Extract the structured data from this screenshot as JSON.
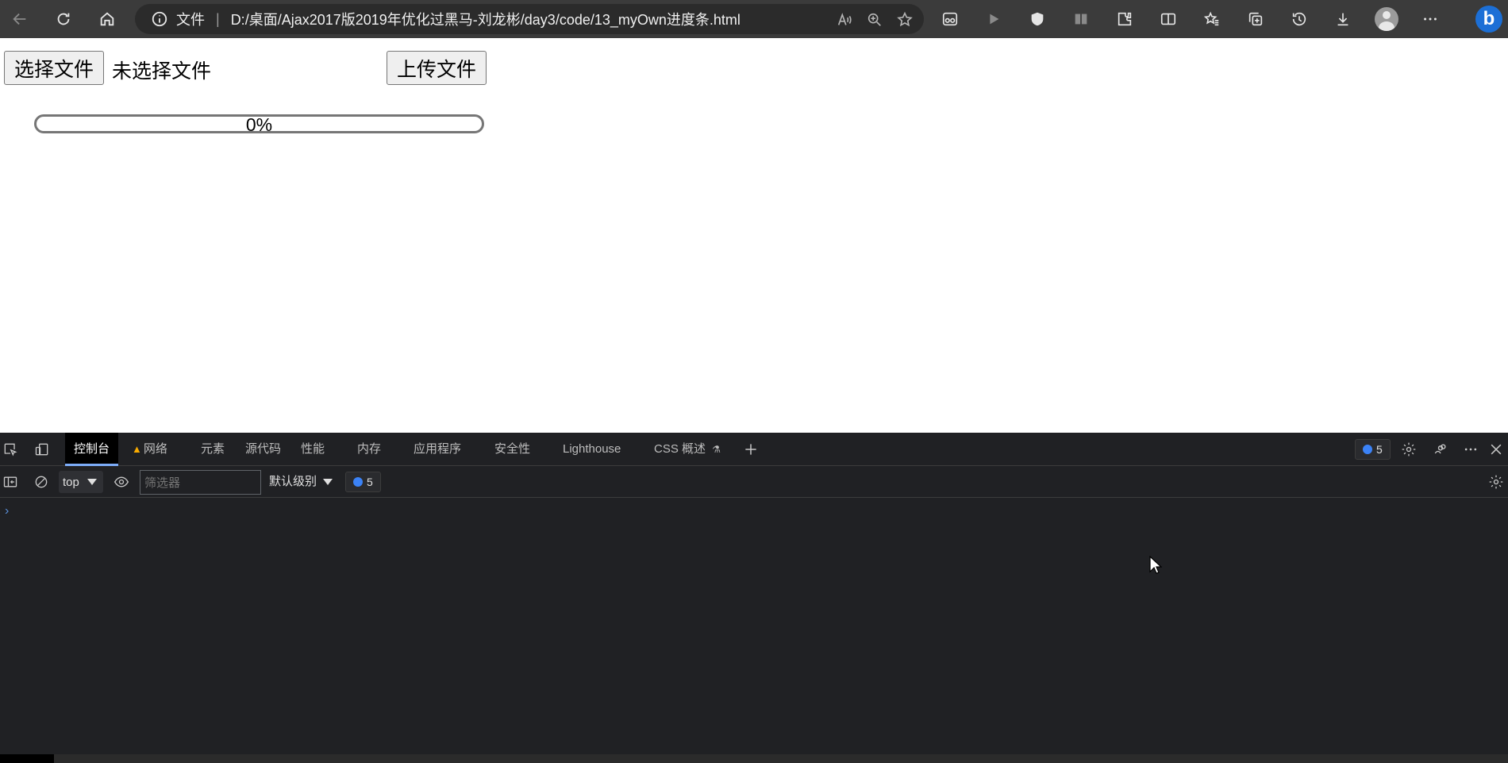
{
  "browser": {
    "address": {
      "scheme_label": "文件",
      "url": "D:/桌面/Ajax2017版2019年优化过黑马-刘龙彬/day3/code/13_myOwn进度条.html"
    }
  },
  "page": {
    "choose_file_label": "选择文件",
    "file_status": "未选择文件",
    "upload_label": "上传文件",
    "progress": {
      "value": 0,
      "text": "0%",
      "fill_color": "#4caf50"
    }
  },
  "devtools": {
    "tabs": [
      {
        "label": "控制台"
      },
      {
        "label": "网络"
      },
      {
        "label": "元素"
      },
      {
        "label": "源代码"
      },
      {
        "label": "性能"
      },
      {
        "label": "内存"
      },
      {
        "label": "应用程序"
      },
      {
        "label": "安全性"
      },
      {
        "label": "Lighthouse"
      },
      {
        "label": "CSS 概述"
      }
    ],
    "issues_count": "5",
    "context": "top",
    "filter_placeholder": "筛选器",
    "level": "默认级别",
    "message_count": "5",
    "prompt": "›"
  },
  "colors": {
    "accent": "#7cacf8",
    "warning": "#f9ab00",
    "devtools_bg": "#202124",
    "toolbar_bg": "#3b3b3b"
  }
}
